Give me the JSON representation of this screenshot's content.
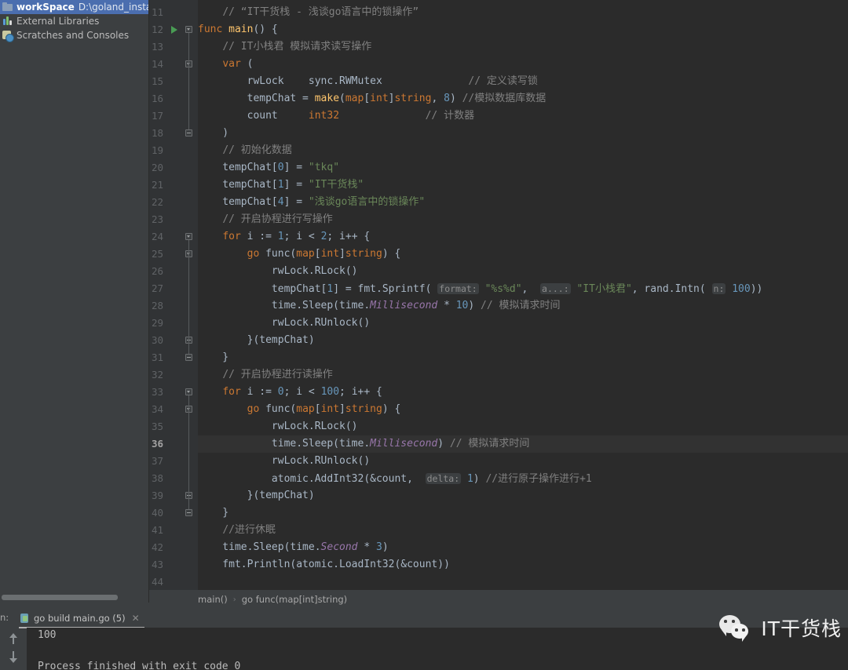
{
  "sidebar": {
    "items": [
      {
        "label": "workSpace",
        "path": "D:\\goland_install\\w",
        "icon": "folder-icon",
        "selected": true
      },
      {
        "label": "External Libraries",
        "path": "",
        "icon": "library-icon",
        "selected": false
      },
      {
        "label": "Scratches and Consoles",
        "path": "",
        "icon": "clock-icon",
        "selected": false
      }
    ]
  },
  "editor": {
    "current_line": 36,
    "run_marker_line": 12,
    "first_line": 11,
    "last_line": 44,
    "lines": [
      {
        "n": 11,
        "fold": "",
        "tokens": [
          {
            "t": "    ",
            "c": "pln"
          },
          {
            "t": "// “IT干货栈 - 浅谈go语言中的锁操作”",
            "c": "cmt"
          }
        ]
      },
      {
        "n": 12,
        "fold": "open",
        "run": true,
        "tokens": [
          {
            "t": "func ",
            "c": "kw"
          },
          {
            "t": "main",
            "c": "fn"
          },
          {
            "t": "() {",
            "c": "pln"
          }
        ]
      },
      {
        "n": 13,
        "fold": "",
        "tokens": [
          {
            "t": "    ",
            "c": "pln"
          },
          {
            "t": "// IT小栈君 模拟请求读写操作",
            "c": "cmt"
          }
        ]
      },
      {
        "n": 14,
        "fold": "open",
        "tokens": [
          {
            "t": "    ",
            "c": "pln"
          },
          {
            "t": "var",
            "c": "kw"
          },
          {
            "t": " (",
            "c": "pln"
          }
        ]
      },
      {
        "n": 15,
        "fold": "",
        "tokens": [
          {
            "t": "        rwLock    sync.",
            "c": "pln"
          },
          {
            "t": "RWMutex",
            "c": "pln"
          },
          {
            "t": "              ",
            "c": "pln"
          },
          {
            "t": "// 定义读写锁",
            "c": "cmt"
          }
        ]
      },
      {
        "n": 16,
        "fold": "",
        "tokens": [
          {
            "t": "        tempChat = ",
            "c": "pln"
          },
          {
            "t": "make",
            "c": "fn"
          },
          {
            "t": "(",
            "c": "pln"
          },
          {
            "t": "map",
            "c": "kw"
          },
          {
            "t": "[",
            "c": "pln"
          },
          {
            "t": "int",
            "c": "typ"
          },
          {
            "t": "]",
            "c": "pln"
          },
          {
            "t": "string",
            "c": "typ"
          },
          {
            "t": ", ",
            "c": "pln"
          },
          {
            "t": "8",
            "c": "num"
          },
          {
            "t": ") ",
            "c": "pln"
          },
          {
            "t": "//模拟数据库数据",
            "c": "cmt"
          }
        ]
      },
      {
        "n": 17,
        "fold": "",
        "tokens": [
          {
            "t": "        count     ",
            "c": "pln"
          },
          {
            "t": "int32",
            "c": "typ"
          },
          {
            "t": "              ",
            "c": "pln"
          },
          {
            "t": "// 计数器",
            "c": "cmt"
          }
        ]
      },
      {
        "n": 18,
        "fold": "close",
        "tokens": [
          {
            "t": "    )",
            "c": "pln"
          }
        ]
      },
      {
        "n": 19,
        "fold": "",
        "tokens": [
          {
            "t": "    ",
            "c": "pln"
          },
          {
            "t": "// 初始化数据",
            "c": "cmt"
          }
        ]
      },
      {
        "n": 20,
        "fold": "",
        "tokens": [
          {
            "t": "    tempChat[",
            "c": "pln"
          },
          {
            "t": "0",
            "c": "num"
          },
          {
            "t": "] = ",
            "c": "pln"
          },
          {
            "t": "\"tkq\"",
            "c": "str"
          }
        ]
      },
      {
        "n": 21,
        "fold": "",
        "tokens": [
          {
            "t": "    tempChat[",
            "c": "pln"
          },
          {
            "t": "1",
            "c": "num"
          },
          {
            "t": "] = ",
            "c": "pln"
          },
          {
            "t": "\"IT干货栈\"",
            "c": "str"
          }
        ]
      },
      {
        "n": 22,
        "fold": "",
        "tokens": [
          {
            "t": "    tempChat[",
            "c": "pln"
          },
          {
            "t": "4",
            "c": "num"
          },
          {
            "t": "] = ",
            "c": "pln"
          },
          {
            "t": "\"浅谈go语言中的锁操作\"",
            "c": "str"
          }
        ]
      },
      {
        "n": 23,
        "fold": "",
        "tokens": [
          {
            "t": "    ",
            "c": "pln"
          },
          {
            "t": "// 开启协程进行写操作",
            "c": "cmt"
          }
        ]
      },
      {
        "n": 24,
        "fold": "open",
        "tokens": [
          {
            "t": "    ",
            "c": "pln"
          },
          {
            "t": "for",
            "c": "kw"
          },
          {
            "t": " i := ",
            "c": "pln"
          },
          {
            "t": "1",
            "c": "num"
          },
          {
            "t": "; i < ",
            "c": "pln"
          },
          {
            "t": "2",
            "c": "num"
          },
          {
            "t": "; i++ {",
            "c": "pln"
          }
        ]
      },
      {
        "n": 25,
        "fold": "open",
        "tokens": [
          {
            "t": "        ",
            "c": "pln"
          },
          {
            "t": "go",
            "c": "kw"
          },
          {
            "t": " func(",
            "c": "pln"
          },
          {
            "t": "map",
            "c": "kw"
          },
          {
            "t": "[",
            "c": "pln"
          },
          {
            "t": "int",
            "c": "typ"
          },
          {
            "t": "]",
            "c": "pln"
          },
          {
            "t": "string",
            "c": "typ"
          },
          {
            "t": ") {",
            "c": "pln"
          }
        ]
      },
      {
        "n": 26,
        "fold": "",
        "tokens": [
          {
            "t": "            rwLock.RLock()",
            "c": "pln"
          }
        ]
      },
      {
        "n": 27,
        "fold": "",
        "tokens": [
          {
            "t": "            tempChat[",
            "c": "pln"
          },
          {
            "t": "1",
            "c": "num"
          },
          {
            "t": "] = fmt.Sprintf( ",
            "c": "pln"
          },
          {
            "t": "format:",
            "c": "hint"
          },
          {
            "t": " ",
            "c": "pln"
          },
          {
            "t": "\"%s%d\"",
            "c": "str"
          },
          {
            "t": ",  ",
            "c": "pln"
          },
          {
            "t": "a...:",
            "c": "hint"
          },
          {
            "t": " ",
            "c": "pln"
          },
          {
            "t": "\"IT小栈君\"",
            "c": "str"
          },
          {
            "t": ", rand.Intn( ",
            "c": "pln"
          },
          {
            "t": "n:",
            "c": "hint"
          },
          {
            "t": " ",
            "c": "pln"
          },
          {
            "t": "100",
            "c": "num"
          },
          {
            "t": "))",
            "c": "pln"
          }
        ]
      },
      {
        "n": 28,
        "fold": "",
        "tokens": [
          {
            "t": "            time.Sleep(time.",
            "c": "pln"
          },
          {
            "t": "Millisecond",
            "c": "cst"
          },
          {
            "t": " * ",
            "c": "pln"
          },
          {
            "t": "10",
            "c": "num"
          },
          {
            "t": ") ",
            "c": "pln"
          },
          {
            "t": "// 模拟请求时间",
            "c": "cmt"
          }
        ]
      },
      {
        "n": 29,
        "fold": "",
        "tokens": [
          {
            "t": "            rwLock.RUnlock()",
            "c": "pln"
          }
        ]
      },
      {
        "n": 30,
        "fold": "close",
        "tokens": [
          {
            "t": "        }(tempChat)",
            "c": "pln"
          }
        ]
      },
      {
        "n": 31,
        "fold": "close",
        "tokens": [
          {
            "t": "    }",
            "c": "pln"
          }
        ]
      },
      {
        "n": 32,
        "fold": "",
        "tokens": [
          {
            "t": "    ",
            "c": "pln"
          },
          {
            "t": "// 开启协程进行读操作",
            "c": "cmt"
          }
        ]
      },
      {
        "n": 33,
        "fold": "open",
        "tokens": [
          {
            "t": "    ",
            "c": "pln"
          },
          {
            "t": "for",
            "c": "kw"
          },
          {
            "t": " i := ",
            "c": "pln"
          },
          {
            "t": "0",
            "c": "num"
          },
          {
            "t": "; i < ",
            "c": "pln"
          },
          {
            "t": "100",
            "c": "num"
          },
          {
            "t": "; i++ {",
            "c": "pln"
          }
        ]
      },
      {
        "n": 34,
        "fold": "open",
        "tokens": [
          {
            "t": "        ",
            "c": "pln"
          },
          {
            "t": "go",
            "c": "kw"
          },
          {
            "t": " func(",
            "c": "pln"
          },
          {
            "t": "map",
            "c": "kw"
          },
          {
            "t": "[",
            "c": "pln"
          },
          {
            "t": "int",
            "c": "typ"
          },
          {
            "t": "]",
            "c": "pln"
          },
          {
            "t": "string",
            "c": "typ"
          },
          {
            "t": ") {",
            "c": "pln"
          }
        ]
      },
      {
        "n": 35,
        "fold": "",
        "tokens": [
          {
            "t": "            rwLock.RLock()",
            "c": "pln"
          }
        ]
      },
      {
        "n": 36,
        "fold": "",
        "current": true,
        "tokens": [
          {
            "t": "            time.Sleep(time.",
            "c": "pln"
          },
          {
            "t": "Millisecond",
            "c": "cst"
          },
          {
            "t": ") ",
            "c": "pln"
          },
          {
            "t": "// 模拟请求时间",
            "c": "cmt"
          }
        ]
      },
      {
        "n": 37,
        "fold": "",
        "tokens": [
          {
            "t": "            rwLock.RUnlock()",
            "c": "pln"
          }
        ]
      },
      {
        "n": 38,
        "fold": "",
        "tokens": [
          {
            "t": "            atomic.AddInt32(&count,  ",
            "c": "pln"
          },
          {
            "t": "delta:",
            "c": "hint"
          },
          {
            "t": " ",
            "c": "pln"
          },
          {
            "t": "1",
            "c": "num"
          },
          {
            "t": ") ",
            "c": "pln"
          },
          {
            "t": "//进行原子操作进行+1",
            "c": "cmt"
          }
        ]
      },
      {
        "n": 39,
        "fold": "close",
        "tokens": [
          {
            "t": "        }(tempChat)",
            "c": "pln"
          }
        ]
      },
      {
        "n": 40,
        "fold": "close",
        "tokens": [
          {
            "t": "    }",
            "c": "pln"
          }
        ]
      },
      {
        "n": 41,
        "fold": "",
        "tokens": [
          {
            "t": "    ",
            "c": "pln"
          },
          {
            "t": "//进行休眠",
            "c": "cmt"
          }
        ]
      },
      {
        "n": 42,
        "fold": "",
        "tokens": [
          {
            "t": "    time.Sleep(time.",
            "c": "pln"
          },
          {
            "t": "Second",
            "c": "cst"
          },
          {
            "t": " * ",
            "c": "pln"
          },
          {
            "t": "3",
            "c": "num"
          },
          {
            "t": ")",
            "c": "pln"
          }
        ]
      },
      {
        "n": 43,
        "fold": "",
        "tokens": [
          {
            "t": "    fmt.Println(atomic.LoadInt32(&count))",
            "c": "pln"
          }
        ]
      },
      {
        "n": 44,
        "fold": "",
        "tokens": []
      }
    ]
  },
  "breadcrumb": {
    "items": [
      "main()",
      "go func(map[int]string)"
    ],
    "separator": "›"
  },
  "run_panel": {
    "label": "n:",
    "tab_title": "go build main.go (5)",
    "close_label": "✕",
    "scroll_up_icon": "arrow-up-icon",
    "scroll_down_icon": "arrow-down-icon",
    "console_lines": [
      "100",
      "",
      "Process finished with exit code 0"
    ]
  },
  "watermark": {
    "text": "IT干货栈",
    "icon": "wechat-icon"
  },
  "colors": {
    "editor_bg": "#2b2b2b",
    "panel_bg": "#3c3f41",
    "gutter_bg": "#313335",
    "selection_blue": "#4b6eaf",
    "keyword_orange": "#cc7832",
    "function_yellow": "#ffc66d",
    "string_green": "#6a8759",
    "number_blue": "#6897bb",
    "comment_gray": "#808080",
    "constant_purple": "#9876aa",
    "default_text": "#a9b7c6",
    "run_green": "#499c54"
  }
}
